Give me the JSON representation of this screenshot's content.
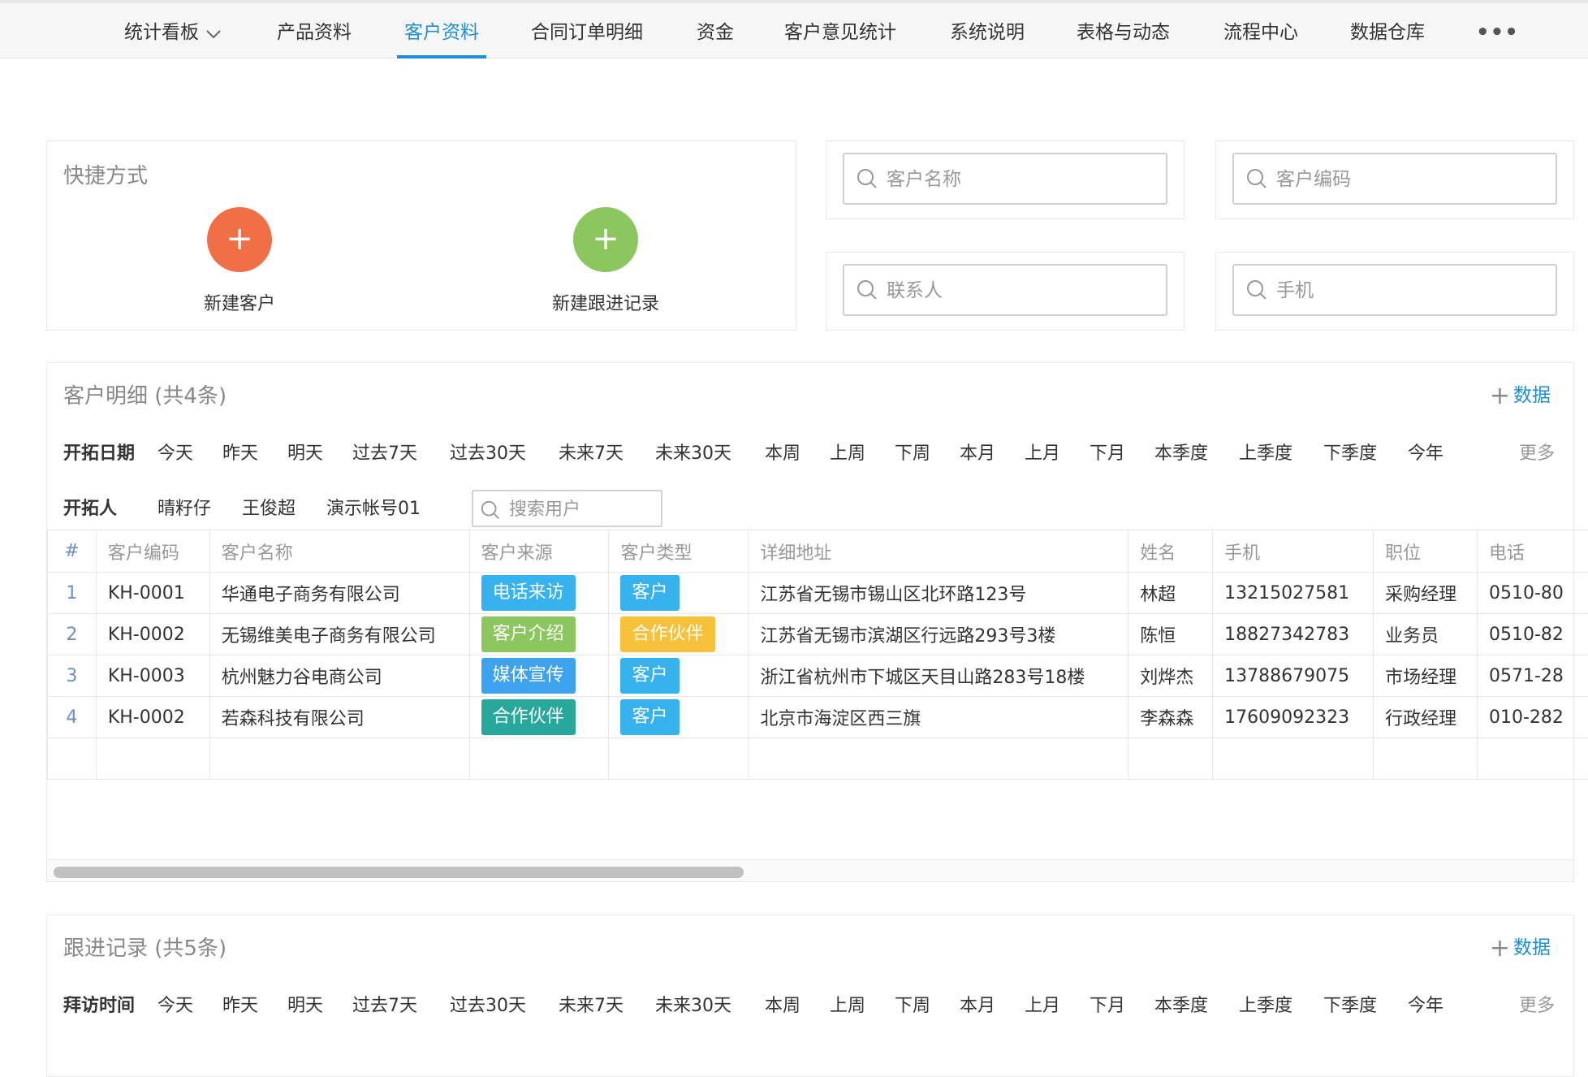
{
  "nav": {
    "items": [
      {
        "label": "统计看板",
        "dropdown": true
      },
      {
        "label": "产品资料"
      },
      {
        "label": "客户资料",
        "active": true
      },
      {
        "label": "合同订单明细"
      },
      {
        "label": "资金"
      },
      {
        "label": "客户意见统计"
      },
      {
        "label": "系统说明"
      },
      {
        "label": "表格与动态"
      },
      {
        "label": "流程中心"
      },
      {
        "label": "数据仓库"
      }
    ],
    "more": "•••"
  },
  "quick": {
    "title": "快捷方式",
    "new_customer": "新建客户",
    "new_followup": "新建跟进记录",
    "plus": "+"
  },
  "search": {
    "customer_name": "客户名称",
    "customer_code": "客户编码",
    "contact": "联系人",
    "mobile": "手机"
  },
  "customers": {
    "title": "客户明细 (共4条)",
    "add_label": "数据",
    "plus": "+",
    "date_filter_label": "开拓日期",
    "user_filter_label": "开拓人",
    "date_options": [
      "今天",
      "昨天",
      "明天",
      "过去7天",
      "过去30天",
      "未来7天",
      "未来30天",
      "本周",
      "上周",
      "下周",
      "本月",
      "上月",
      "下月",
      "本季度",
      "上季度",
      "下季度",
      "今年"
    ],
    "more": "更多",
    "users": [
      "晴籽仔",
      "王俊超",
      "演示帐号01"
    ],
    "user_search_placeholder": "搜索用户",
    "columns": [
      "#",
      "客户编码",
      "客户名称",
      "客户来源",
      "客户类型",
      "详细地址",
      "姓名",
      "手机",
      "职位",
      "电话"
    ],
    "rows": [
      {
        "idx": "1",
        "code": "KH-0001",
        "name": "华通电子商务有限公司",
        "source": "电话来访",
        "type": "客户",
        "address": "江苏省无锡市锡山区北环路123号",
        "person": "林超",
        "mobile": "13215027581",
        "position": "采购经理",
        "phone": "0510-80"
      },
      {
        "idx": "2",
        "code": "KH-0002",
        "name": "无锡维美电子商务有限公司",
        "source": "客户介绍",
        "type": "合作伙伴",
        "address": "江苏省无锡市滨湖区行远路293号3楼",
        "person": "陈恒",
        "mobile": "18827342783",
        "position": "业务员",
        "phone": "0510-82"
      },
      {
        "idx": "3",
        "code": "KH-0003",
        "name": "杭州魅力谷电商公司",
        "source": "媒体宣传",
        "type": "客户",
        "address": "浙江省杭州市下城区天目山路283号18楼",
        "person": "刘烨杰",
        "mobile": "13788679075",
        "position": "市场经理",
        "phone": "0571-28"
      },
      {
        "idx": "4",
        "code": "KH-0002",
        "name": "若森科技有限公司",
        "source": "合作伙伴",
        "type": "客户",
        "address": "北京市海淀区西三旗",
        "person": "李森森",
        "mobile": "17609092323",
        "position": "行政经理",
        "phone": "010-282"
      }
    ],
    "tag_colors": {
      "电话来访": "#36b3ef",
      "客户介绍": "#8cc65f",
      "媒体宣传": "#3ea3ee",
      "合作伙伴": "#26a89a",
      "客户": "#36b3ef",
      "合作伙伴_type": "#f7c23a"
    }
  },
  "followups": {
    "title": "跟进记录 (共5条)",
    "add_label": "数据",
    "plus": "+",
    "date_filter_label": "拜访时间",
    "date_options": [
      "今天",
      "昨天",
      "明天",
      "过去7天",
      "过去30天",
      "未来7天",
      "未来30天",
      "本周",
      "上周",
      "下周",
      "本月",
      "上月",
      "下月",
      "本季度",
      "上季度",
      "下季度",
      "今年"
    ],
    "more": "更多"
  },
  "colors": {
    "accent": "#1e8fd6",
    "new_customer_btn": "#f06f45",
    "new_followup_btn": "#8cc65f"
  }
}
